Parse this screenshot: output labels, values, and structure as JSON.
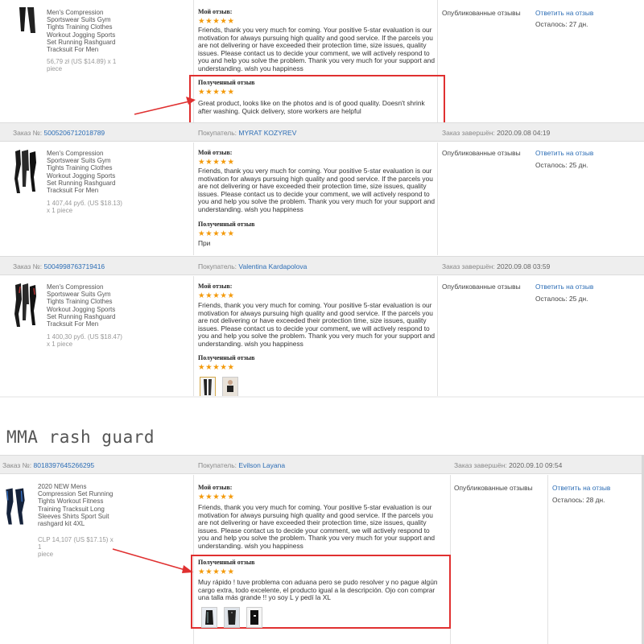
{
  "caption": "MMA rash guard",
  "labels": {
    "order": "Заказ №:",
    "buyer": "Покупатель:",
    "completed": "Заказ завершён:",
    "my_review": "Мой отзыв:",
    "received_review": "Полученный отзыв",
    "published": "Опубликованные отзывы",
    "reply": "Ответить на отзыв",
    "stars": "★★★★★"
  },
  "seller_review_text": "Friends, thank you very much for coming. Your positive 5-star evaluation is our motivation for always pursuing high quality and good service. If the parcels you are not delivering or have exceeded their protection time, size issues, quality issues. Please contact us to decide your comment, we will actively respond to you and help you solve the problem. Thank you very much for your support and understanding. wish you happiness",
  "seller_review_text_alt": "Friends, thank you very much for coming. Your positive 5-star evaluation is our motivation for always pursuing high quality and good service. If the parcels you are not delivering or have exceeded their protection time, size issues, quality issues. Please contact us to decide your comment, we will actively respond to you and help you solve the problem. Thank you very much for your support and understanding. wish you happiness",
  "orders": [
    {
      "product": "Men's Compression Sportswear Suits Gym Tights Training Clothes Workout Jogging Sports Set Running Rashguard Tracksuit For Men",
      "price_line1": "56,79 zł (US $14.89) x 1",
      "price_line2": "piece",
      "received": "Great product, looks like on the photos and is of good quality. Doesn't shrink after washing. Quick delivery, store workers are helpful",
      "remaining": "Осталось: 27 дн."
    },
    {
      "order_no": "5005206712018789",
      "buyer": "MYRAT KOZYREV",
      "completed": "2020.09.08 04:19",
      "product": "Men's Compression Sportswear Suits Gym Tights Training Clothes Workout Jogging Sports Set Running Rashguard Tracksuit For Men",
      "price_line1": "1 407,44 руб. (US $18.13)",
      "price_line2": "x 1 piece",
      "received": "При",
      "remaining": "Осталось: 25 дн."
    },
    {
      "order_no": "5004998763719416",
      "buyer": "Valentina Kardapolova",
      "completed": "2020.09.08 03:59",
      "product": "Men's Compression Sportswear Suits Gym Tights Training Clothes Workout Jogging Sports Set Running Rashguard Tracksuit For Men",
      "price_line1": "1 400,30 руб. (US $18.47)",
      "price_line2": "x 1 piece",
      "remaining": "Осталось: 25 дн."
    },
    {
      "order_no": "8018397645266295",
      "buyer": "Evilson Layana",
      "completed": "2020.09.10 09:54",
      "product": "2020 NEW Mens Compression Set Running Tights Workout Fitness Training Tracksuit Long Sleeves Shirts Sport Suit rashgard kit 4XL",
      "price_line1": "CLP 14,107 (US $17.15) x 1",
      "price_line2": "piece",
      "received": "Muy rápido ! tuve problema con aduana pero se pudo resolver y no pague algún cargo extra, todo excelente, el producto igual a la descripción. Ojo con comprar una talla más grande !! yo soy L y pedí la XL",
      "remaining": "Осталось: 28 дн."
    }
  ]
}
